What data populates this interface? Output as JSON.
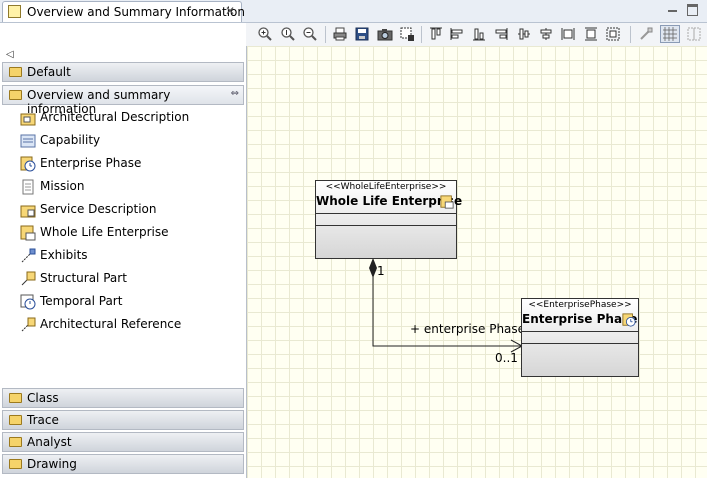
{
  "tab": {
    "title": "Overview and Summary Information",
    "close": "✕"
  },
  "palette": {
    "collapse_glyph": "◁",
    "drawers_top": [
      {
        "label": "Default"
      },
      {
        "label": "Overview and summary information"
      }
    ],
    "items": [
      {
        "label": "Architectural Description",
        "icon": "architectural-description-icon"
      },
      {
        "label": "Capability",
        "icon": "capability-icon"
      },
      {
        "label": "Enterprise Phase",
        "icon": "enterprise-phase-icon"
      },
      {
        "label": "Mission",
        "icon": "mission-icon"
      },
      {
        "label": "Service Description",
        "icon": "service-description-icon"
      },
      {
        "label": "Whole Life Enterprise",
        "icon": "whole-life-enterprise-icon"
      },
      {
        "label": "Exhibits",
        "icon": "exhibits-connector-icon"
      },
      {
        "label": "Structural Part",
        "icon": "structural-part-icon"
      },
      {
        "label": "Temporal Part",
        "icon": "temporal-part-icon"
      },
      {
        "label": "Architectural Reference",
        "icon": "architectural-reference-icon"
      }
    ],
    "drawers_bottom": [
      {
        "label": "Class"
      },
      {
        "label": "Trace"
      },
      {
        "label": "Analyst"
      },
      {
        "label": "Drawing"
      }
    ]
  },
  "diagram": {
    "whole_life": {
      "stereotype": "<<WholeLifeEnterprise>>",
      "name": "Whole Life Enterprise"
    },
    "enterprise_phase": {
      "stereotype": "<<EnterprisePhase>>",
      "name": "Enterprise Phase"
    },
    "association": {
      "source_mult": "1",
      "role": "+ enterprise Phase",
      "target_mult": "0..1"
    }
  }
}
